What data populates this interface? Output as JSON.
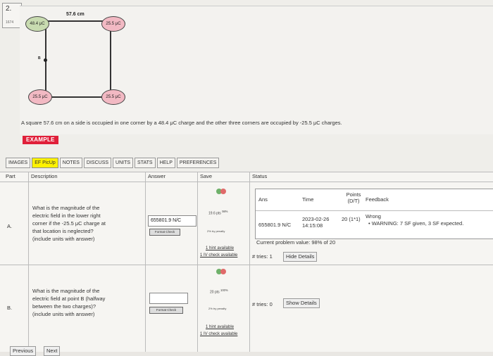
{
  "question": {
    "number": "2.",
    "id": "1674"
  },
  "figure": {
    "side_length": "57.6 cm",
    "charges": {
      "top_left": "48.4 μC",
      "top_right": "25.5 μC",
      "bottom_left": "25.5 μC",
      "bottom_right": "25.5 μC"
    },
    "point_label": "B",
    "colors": {
      "positive": "#c8dbb0",
      "negative": "#f2b9c3"
    }
  },
  "problem_text": "A square 57.6 cm on a side is occupied in one corner by a 48.4 μC charge and the other three corners are occupied by -25.5 μC charges.",
  "example_label": "EXAMPLE",
  "toolbar": [
    "IMAGES",
    "EF PicUp",
    "NOTES",
    "DISCUSS",
    "UNITS",
    "STATS",
    "HELP",
    "PREFERENCES"
  ],
  "table_headers": {
    "part": "Part",
    "description": "Description",
    "answer": "Answer",
    "save": "Save",
    "status": "Status"
  },
  "parts": [
    {
      "part": "A.",
      "description": [
        "What is the magnitude of the",
        "electric field in the lower right",
        "corner if the -25.5 μC charge at",
        "that location is neglected?",
        "(include units with answer)"
      ],
      "answer": "655801.9 N/C",
      "format_check": "Format Check",
      "points": "19.6 pts",
      "points_pct": "98%",
      "penalty": "2% try penalty",
      "hint": "1 hint available",
      "iv_check": "1 IV check available",
      "tries_text": "# tries: 1",
      "details_button": "Hide Details",
      "feedback": {
        "headers": {
          "ans": "Ans",
          "time": "Time",
          "points": "Points (D/T)",
          "feedback": "Feedback"
        },
        "row": {
          "ans": "655801.9 N/C",
          "time": "2023-02-26 14:15:08",
          "points": "20 (1*1)",
          "result": "Wrong",
          "warning": "• WARNING: 7 SF given, 3 SF expected."
        },
        "current_value": "Current problem value: 98% of 20"
      }
    },
    {
      "part": "B.",
      "description": [
        "What is the magnitude of the",
        "electric field at point B (halfway",
        "between the two charges)?",
        "(include units with answer)"
      ],
      "answer": "",
      "format_check": "Format Check",
      "points": "20 pts",
      "points_pct": "100%",
      "penalty": "2% try penalty",
      "hint": "1 hint available",
      "iv_check": "1 IV check available",
      "tries_text": "# tries: 0",
      "details_button": "Show Details"
    }
  ],
  "nav": {
    "previous": "Previous",
    "next": "Next"
  }
}
